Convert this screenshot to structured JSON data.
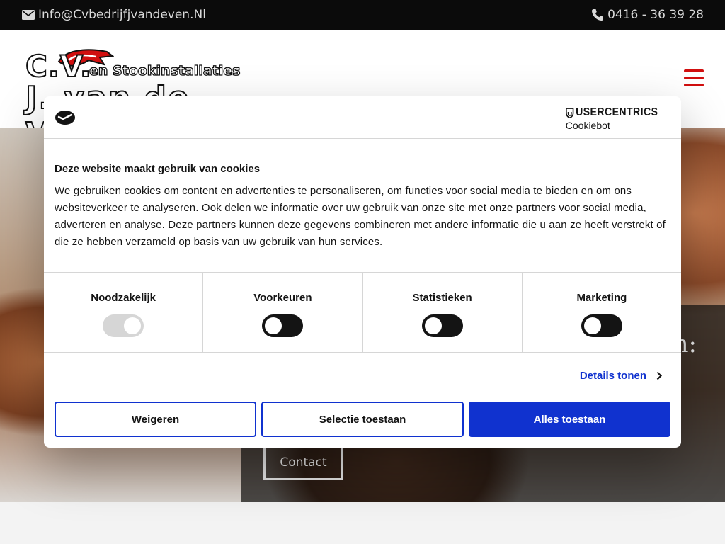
{
  "topbar": {
    "email": "Info@Cvbedrijfjvandeven.Nl",
    "phone": "0416 - 36 39 28"
  },
  "logo": {
    "line1": "C.V.",
    "line2": "en Stookinstallaties",
    "line3": "J. van de Ven"
  },
  "hero": {
    "partial_heading": "n:",
    "contact_button": "Contact"
  },
  "cookie_dialog": {
    "brand_name": "USERCENTRICS",
    "brand_product": "Cookiebot",
    "title": "Deze website maakt gebruik van cookies",
    "body": "We gebruiken cookies om content en advertenties te personaliseren, om functies voor social media te bieden en om ons websiteverkeer te analyseren. Ook delen we informatie over uw gebruik van onze site met onze partners voor social media, adverteren en analyse. Deze partners kunnen deze gegevens combineren met andere informatie die u aan ze heeft verstrekt of die ze hebben verzameld op basis van uw gebruik van hun services.",
    "categories": [
      {
        "label": "Noodzakelijk",
        "enabled": true,
        "locked": true
      },
      {
        "label": "Voorkeuren",
        "enabled": false,
        "locked": false
      },
      {
        "label": "Statistieken",
        "enabled": false,
        "locked": false
      },
      {
        "label": "Marketing",
        "enabled": false,
        "locked": false
      }
    ],
    "details_link": "Details tonen",
    "buttons": {
      "reject": "Weigeren",
      "select": "Selectie toestaan",
      "accept": "Alles toestaan"
    },
    "colors": {
      "accent": "#1032cf",
      "text": "#141414"
    }
  },
  "colors": {
    "brand_red": "#d10f0f",
    "topbar_bg": "#0b0b0b"
  }
}
